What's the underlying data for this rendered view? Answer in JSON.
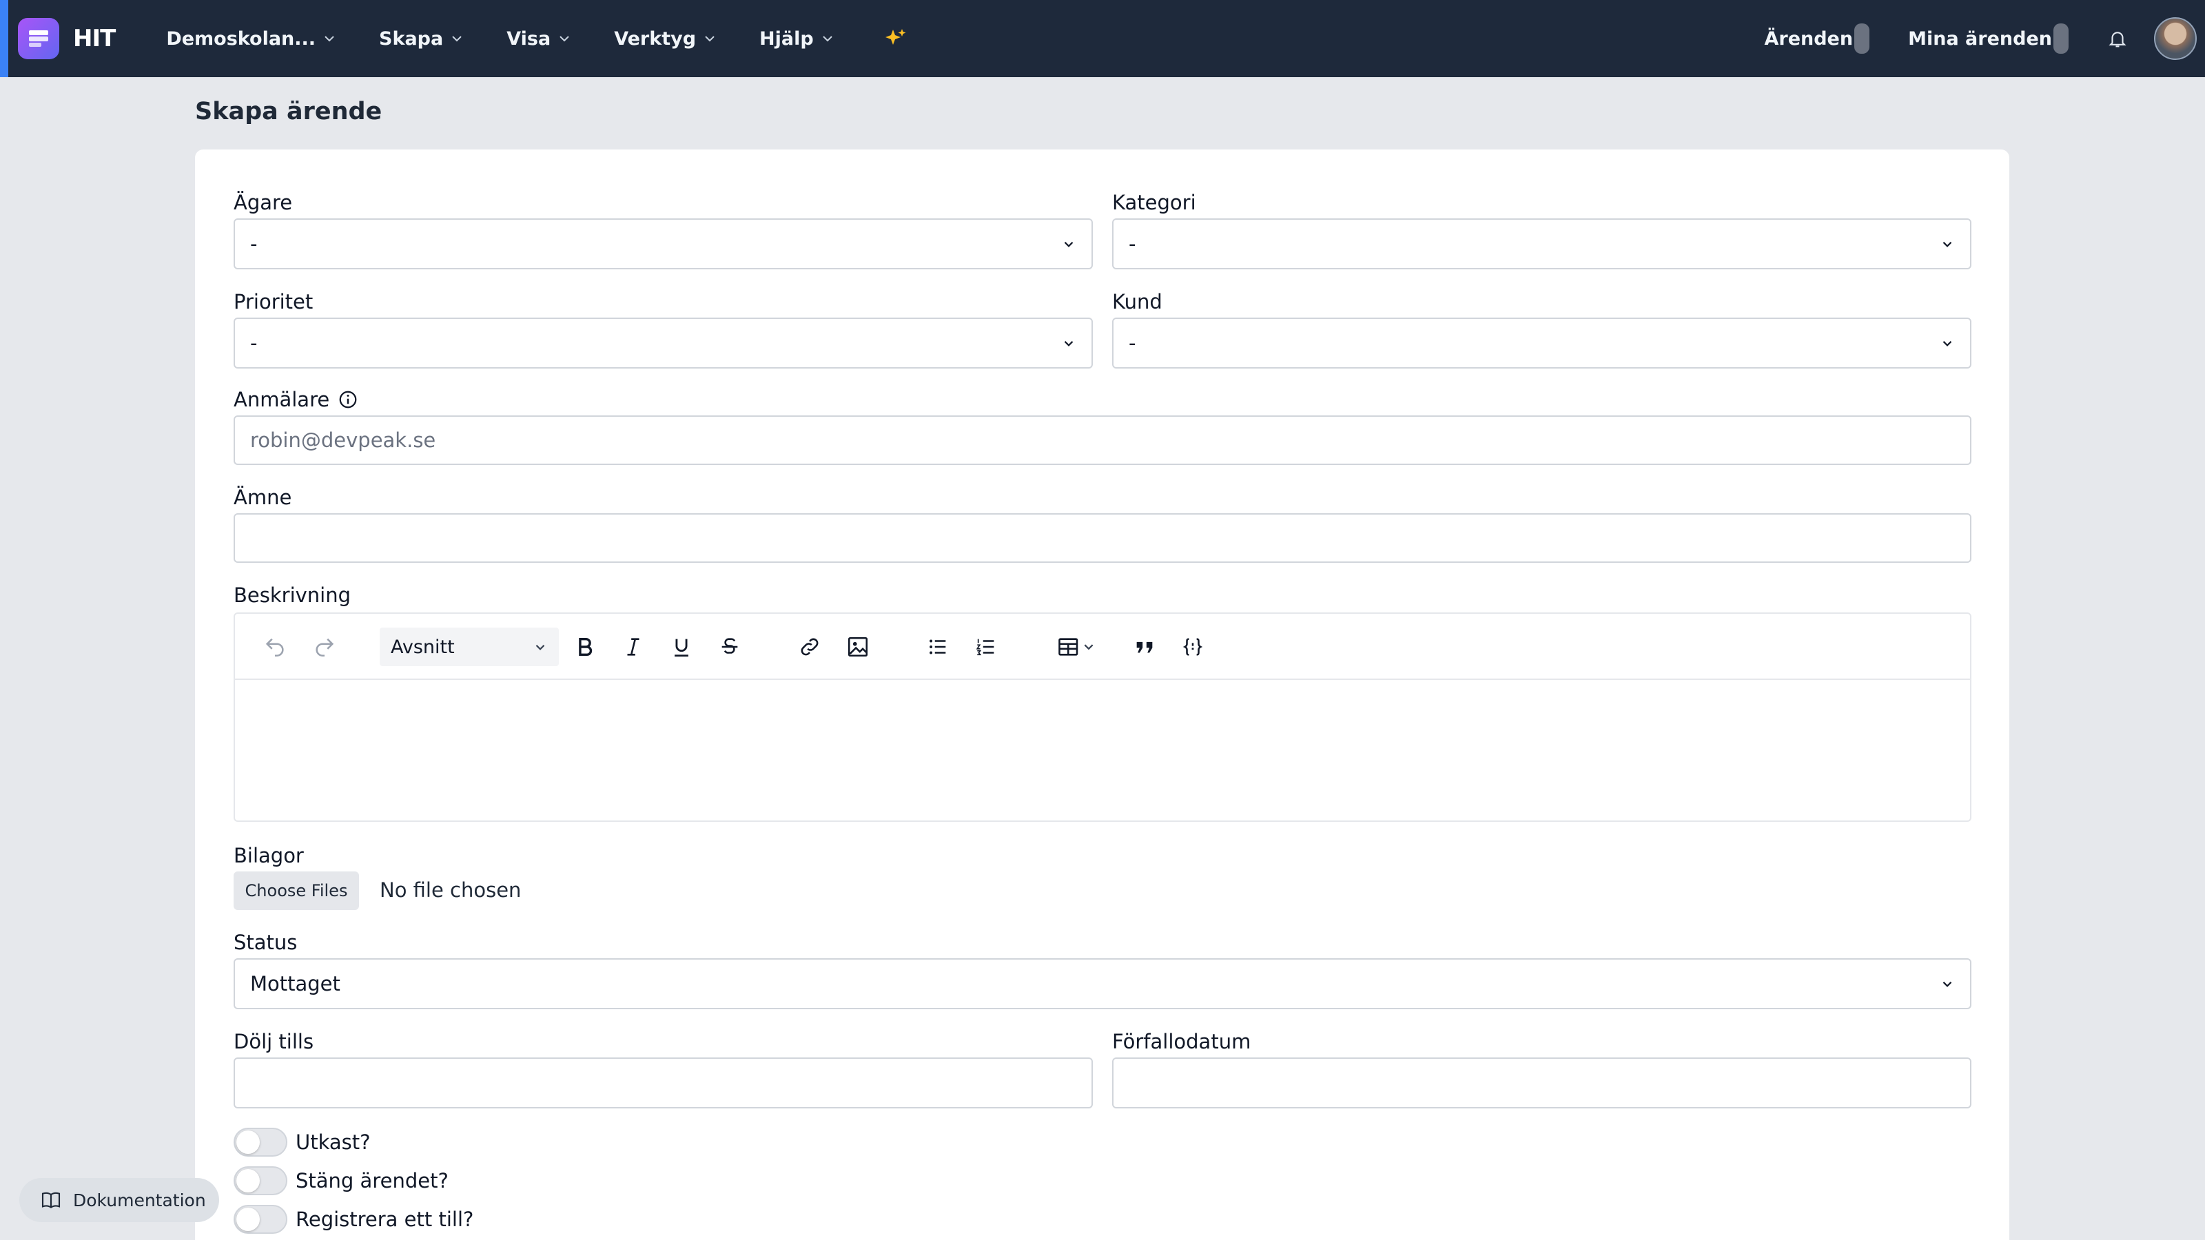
{
  "nav": {
    "brand": "HIT",
    "menu": [
      "Demoskolan...",
      "Skapa",
      "Visa",
      "Verktyg",
      "Hjälp"
    ],
    "right": {
      "arenden": "Ärenden",
      "mina_arenden": "Mina ärenden"
    }
  },
  "page": {
    "title": "Skapa ärende"
  },
  "form": {
    "owner": {
      "label": "Ägare",
      "value": "-"
    },
    "category": {
      "label": "Kategori",
      "value": "-"
    },
    "priority": {
      "label": "Prioritet",
      "value": "-"
    },
    "customer": {
      "label": "Kund",
      "value": "-"
    },
    "reporter": {
      "label": "Anmälare",
      "placeholder": "robin@devpeak.se"
    },
    "subject": {
      "label": "Ämne",
      "value": ""
    },
    "description": {
      "label": "Beskrivning",
      "heading_option": "Avsnitt"
    },
    "attachments": {
      "label": "Bilagor",
      "button": "Choose Files",
      "status": "No file chosen"
    },
    "status": {
      "label": "Status",
      "value": "Mottaget"
    },
    "hide_until": {
      "label": "Dölj tills"
    },
    "due_date": {
      "label": "Förfallodatum"
    },
    "toggles": [
      "Utkast?",
      "Stäng ärendet?",
      "Registrera ett till?"
    ]
  },
  "docs": {
    "label": "Dokumentation"
  },
  "colors": {
    "navbar": "#1e293b",
    "accent": "#3b82f6",
    "logo": "#8b5cf6",
    "sparkle": "#fbbf24"
  }
}
